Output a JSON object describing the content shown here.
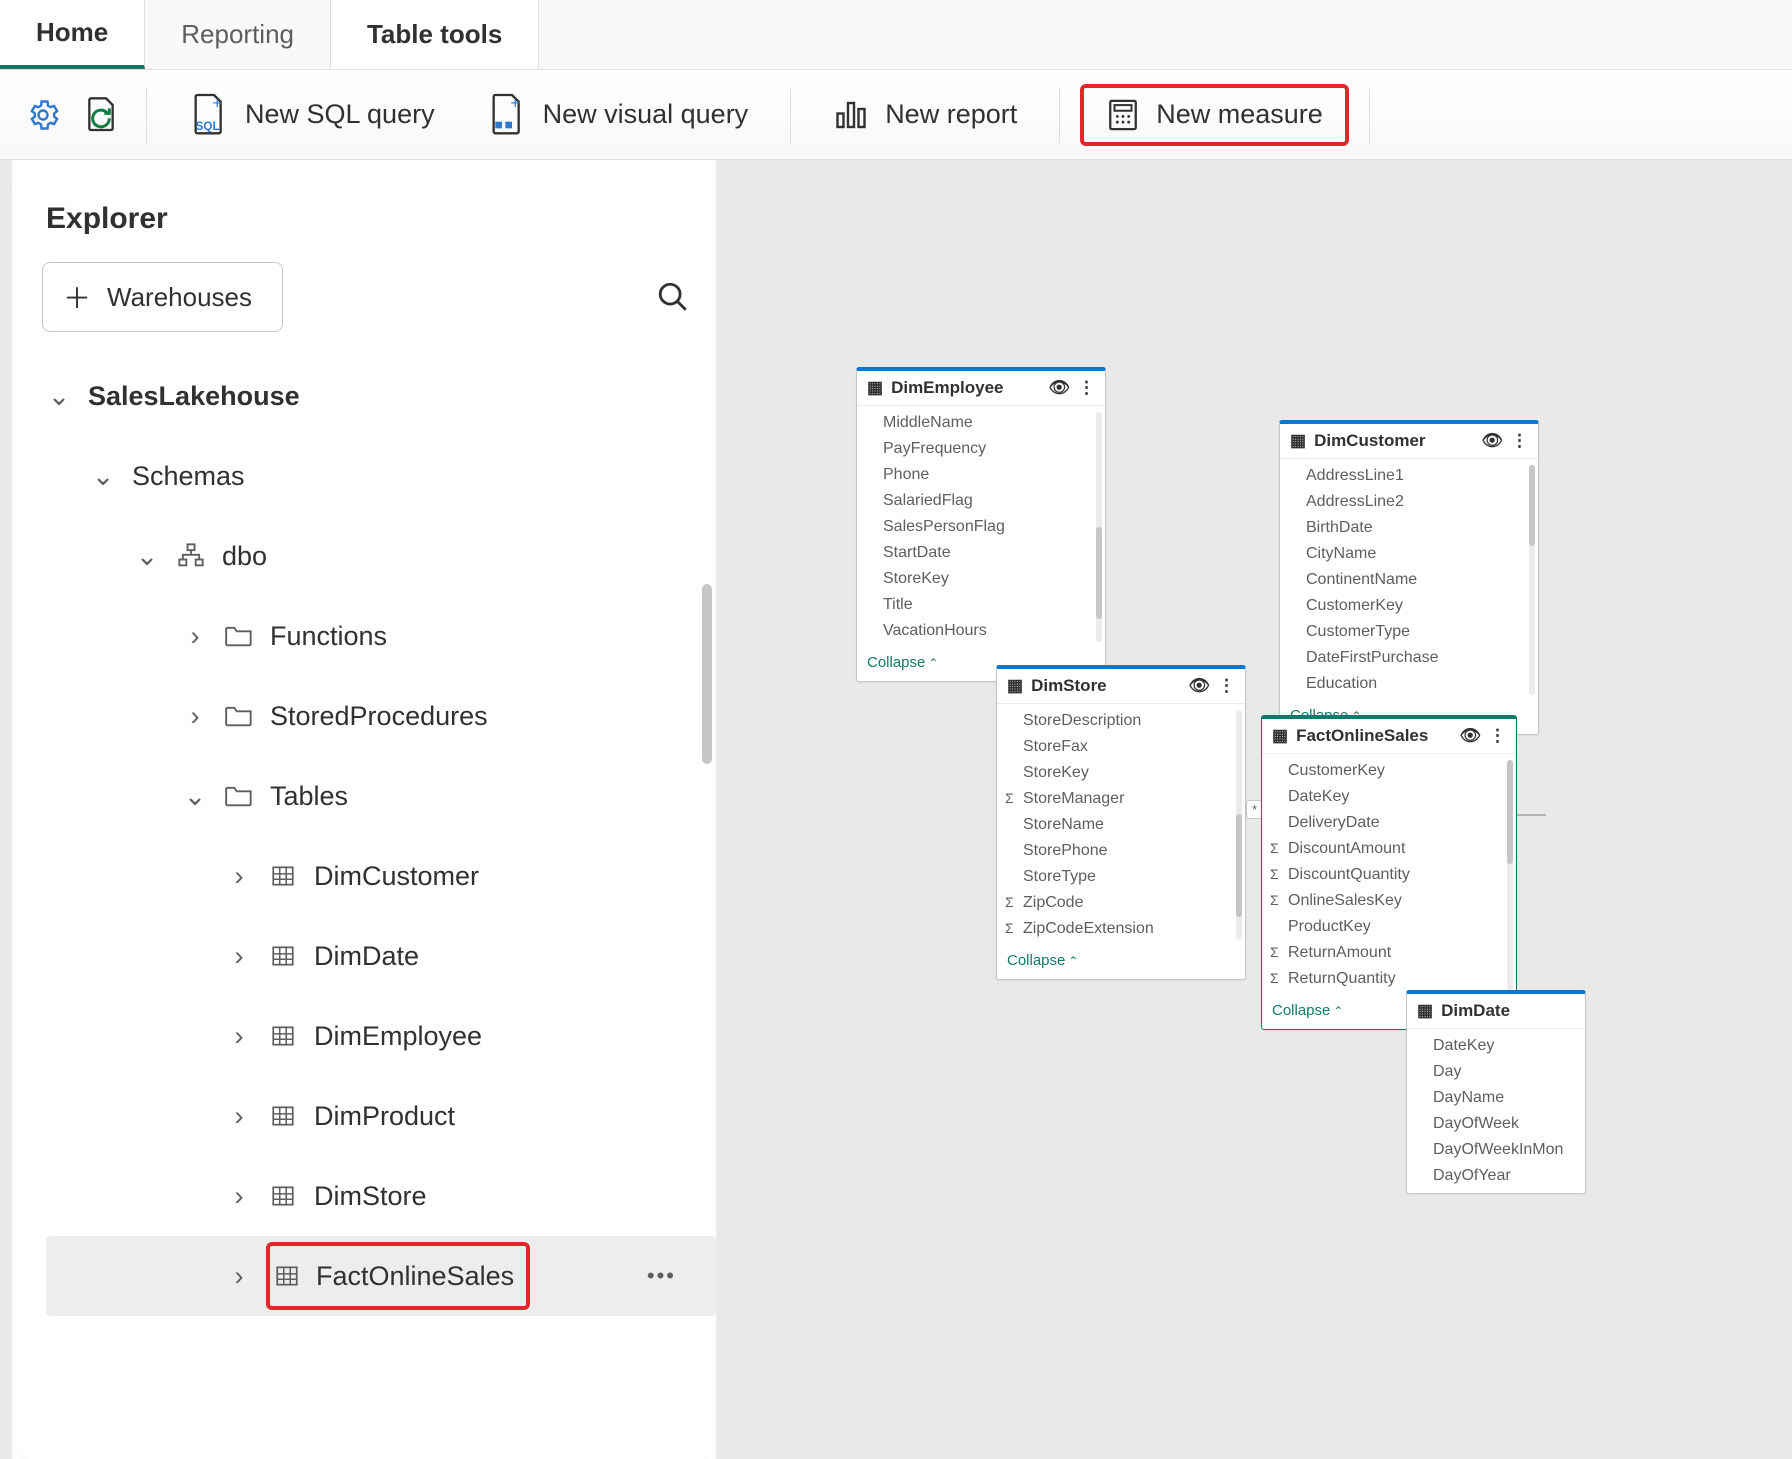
{
  "tabs": {
    "home": "Home",
    "reporting": "Reporting",
    "tableTools": "Table tools"
  },
  "toolbar": {
    "newSqlQuery": "New SQL query",
    "newVisualQuery": "New visual query",
    "newReport": "New report",
    "newMeasure": "New measure"
  },
  "explorer": {
    "title": "Explorer",
    "warehousesBtn": "Warehouses",
    "lakehouse": "SalesLakehouse",
    "schemas": "Schemas",
    "dbo": "dbo",
    "functions": "Functions",
    "storedProcs": "StoredProcedures",
    "tablesFolder": "Tables",
    "tables": {
      "dimCustomer": "DimCustomer",
      "dimDate": "DimDate",
      "dimEmployee": "DimEmployee",
      "dimProduct": "DimProduct",
      "dimStore": "DimStore",
      "factOnlineSales": "FactOnlineSales"
    }
  },
  "canvas": {
    "collapseLabel": "Collapse",
    "dimEmployee": {
      "title": "DimEmployee",
      "cols": [
        "MiddleName",
        "PayFrequency",
        "Phone",
        "SalariedFlag",
        "SalesPersonFlag",
        "StartDate",
        "StoreKey",
        "Title",
        "VacationHours"
      ]
    },
    "dimCustomer": {
      "title": "DimCustomer",
      "cols": [
        "AddressLine1",
        "AddressLine2",
        "BirthDate",
        "CityName",
        "ContinentName",
        "CustomerKey",
        "CustomerType",
        "DateFirstPurchase",
        "Education"
      ]
    },
    "dimStore": {
      "title": "DimStore",
      "cols": [
        "StoreDescription",
        "StoreFax",
        "StoreKey",
        "StoreManager",
        "StoreName",
        "StorePhone",
        "StoreType",
        "ZipCode",
        "ZipCodeExtension"
      ],
      "sigma": [
        3,
        7,
        8
      ]
    },
    "factOnlineSales": {
      "title": "FactOnlineSales",
      "cols": [
        "CustomerKey",
        "DateKey",
        "DeliveryDate",
        "DiscountAmount",
        "DiscountQuantity",
        "OnlineSalesKey",
        "ProductKey",
        "ReturnAmount",
        "ReturnQuantity"
      ],
      "sigma": [
        3,
        4,
        5,
        7,
        8
      ]
    },
    "dimDate": {
      "title": "DimDate",
      "cols": [
        "DateKey",
        "Day",
        "DayName",
        "DayOfWeek",
        "DayOfWeekInMon",
        "DayOfYear"
      ]
    }
  }
}
